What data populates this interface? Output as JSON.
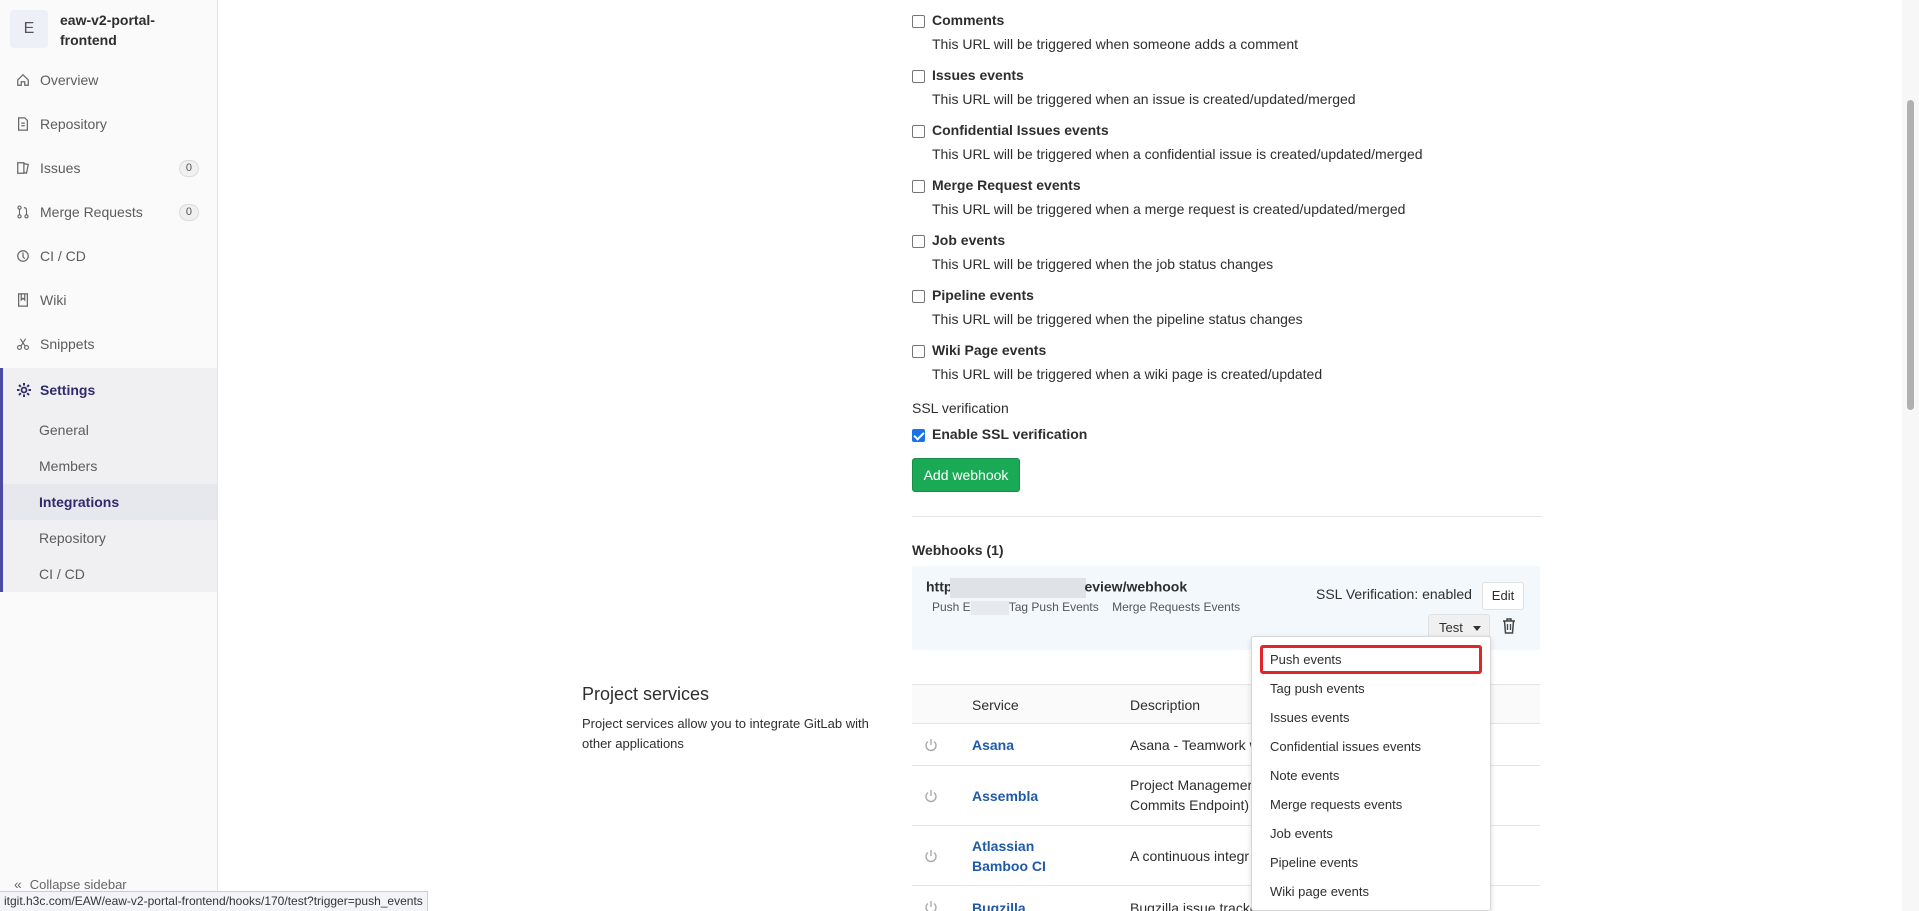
{
  "project": {
    "avatar_letter": "E",
    "name": "eaw-v2-portal-frontend"
  },
  "sidebar": {
    "items": [
      {
        "label": "Overview",
        "icon": "home-icon"
      },
      {
        "label": "Repository",
        "icon": "doc-icon"
      },
      {
        "label": "Issues",
        "icon": "issues-icon",
        "count": "0"
      },
      {
        "label": "Merge Requests",
        "icon": "merge-icon",
        "count": "0"
      },
      {
        "label": "CI / CD",
        "icon": "rocket-icon"
      },
      {
        "label": "Wiki",
        "icon": "book-icon"
      },
      {
        "label": "Snippets",
        "icon": "scissors-icon"
      }
    ],
    "settings": {
      "label": "Settings",
      "sub": [
        "General",
        "Members",
        "Integrations",
        "Repository",
        "CI / CD"
      ],
      "active": "Integrations"
    },
    "collapse_label": "Collapse sidebar"
  },
  "triggers": [
    {
      "label": "Comments",
      "help": "This URL will be triggered when someone adds a comment"
    },
    {
      "label": "Issues events",
      "help": "This URL will be triggered when an issue is created/updated/merged"
    },
    {
      "label": "Confidential Issues events",
      "help": "This URL will be triggered when a confidential issue is created/updated/merged"
    },
    {
      "label": "Merge Request events",
      "help": "This URL will be triggered when a merge request is created/updated/merged"
    },
    {
      "label": "Job events",
      "help": "This URL will be triggered when the job status changes"
    },
    {
      "label": "Pipeline events",
      "help": "This URL will be triggered when the pipeline status changes"
    },
    {
      "label": "Wiki Page events",
      "help": "This URL will be triggered when a wiki page is created/updated"
    }
  ],
  "ssl": {
    "title": "SSL verification",
    "checkbox_label": "Enable SSL verification",
    "checked": true
  },
  "add_webhook_label": "Add webhook",
  "webhooks": {
    "title": "Webhooks (1)",
    "url_prefix": "http",
    "url_suffix": "eview/webhook",
    "events_prefix": "Push E",
    "events_middle": "Tag Push Events",
    "events_last": "Merge Requests Events",
    "ssl_status": "SSL Verification: enabled",
    "edit_label": "Edit",
    "test_label": "Test"
  },
  "project_services": {
    "title": "Project services",
    "description": "Project services allow you to integrate GitLab with other applications",
    "col_service": "Service",
    "col_description": "Description",
    "rows": [
      {
        "name": "Asana",
        "desc": "Asana - Teamwork w"
      },
      {
        "name": "Assembla",
        "desc1": "Project Managemer",
        "desc2": "Commits Endpoint)"
      },
      {
        "name": "Atlassian Bamboo CI",
        "desc": "A continuous integr"
      },
      {
        "name": "Bugzilla",
        "desc": "Bugzilla issue tracke"
      }
    ]
  },
  "test_dropdown": {
    "items": [
      "Push events",
      "Tag push events",
      "Issues events",
      "Confidential issues events",
      "Note events",
      "Merge requests events",
      "Job events",
      "Pipeline events",
      "Wiki page events"
    ],
    "highlighted": "Push events"
  },
  "status_url": "itgit.h3c.com/EAW/eaw-v2-portal-frontend/hooks/170/test?trigger=push_events"
}
